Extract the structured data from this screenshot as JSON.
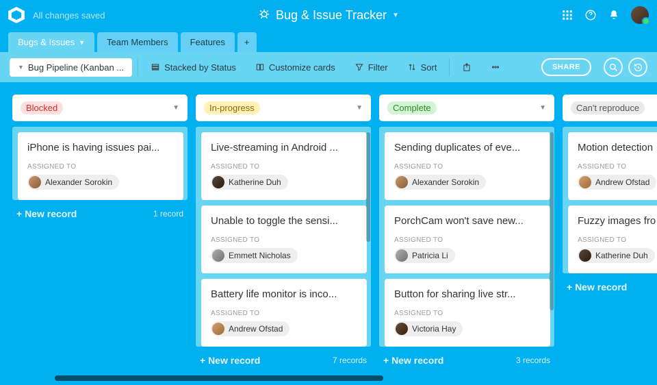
{
  "topbar": {
    "save_status": "All changes saved",
    "title": "Bug & Issue Tracker"
  },
  "tabs": [
    {
      "label": "Bugs & Issues",
      "active": true,
      "hasDropdown": true
    },
    {
      "label": "Team Members",
      "active": false
    },
    {
      "label": "Features",
      "active": false
    }
  ],
  "toolbar": {
    "view_name": "Bug Pipeline (Kanban ...",
    "stack_label": "Stacked by Status",
    "customize_label": "Customize cards",
    "filter_label": "Filter",
    "sort_label": "Sort",
    "share_label": "SHARE"
  },
  "labels": {
    "assigned_to": "ASSIGNED TO",
    "new_record": "+ New record"
  },
  "columns": [
    {
      "name": "Blocked",
      "color_bg": "#ffe0e0",
      "color_fg": "#d52b2b",
      "count_label": "1 record",
      "scrollable": false,
      "cards": [
        {
          "title": "iPhone is having issues pai...",
          "assignee": "Alexander Sorokin",
          "avatar": "av-1"
        }
      ]
    },
    {
      "name": "In-progress",
      "color_bg": "#fff1b8",
      "color_fg": "#8a6d00",
      "count_label": "7 records",
      "scrollable": true,
      "cards": [
        {
          "title": "Live-streaming in Android ...",
          "assignee": "Katherine Duh",
          "avatar": "av-2"
        },
        {
          "title": "Unable to toggle the sensi...",
          "assignee": "Emmett Nicholas",
          "avatar": "av-3"
        },
        {
          "title": "Battery life monitor is inco...",
          "assignee": "Andrew Ofstad",
          "avatar": "av-4"
        }
      ]
    },
    {
      "name": "Complete",
      "color_bg": "#d4f5d4",
      "color_fg": "#2a8a2a",
      "count_label": "3 records",
      "scrollable": true,
      "cards": [
        {
          "title": "Sending duplicates of eve...",
          "assignee": "Alexander Sorokin",
          "avatar": "av-1"
        },
        {
          "title": "PorchCam won't save new...",
          "assignee": "Patricia Li",
          "avatar": "av-3"
        },
        {
          "title": "Button for sharing live str...",
          "assignee": "Victoria Hay",
          "avatar": "av-5"
        }
      ]
    },
    {
      "name": "Can't reproduce",
      "color_bg": "#eaeaea",
      "color_fg": "#555",
      "count_label": "",
      "scrollable": false,
      "cards": [
        {
          "title": "Motion detection",
          "assignee": "Andrew Ofstad",
          "avatar": "av-4"
        },
        {
          "title": "Fuzzy images fro",
          "assignee": "Katherine Duh",
          "avatar": "av-2"
        }
      ]
    }
  ]
}
